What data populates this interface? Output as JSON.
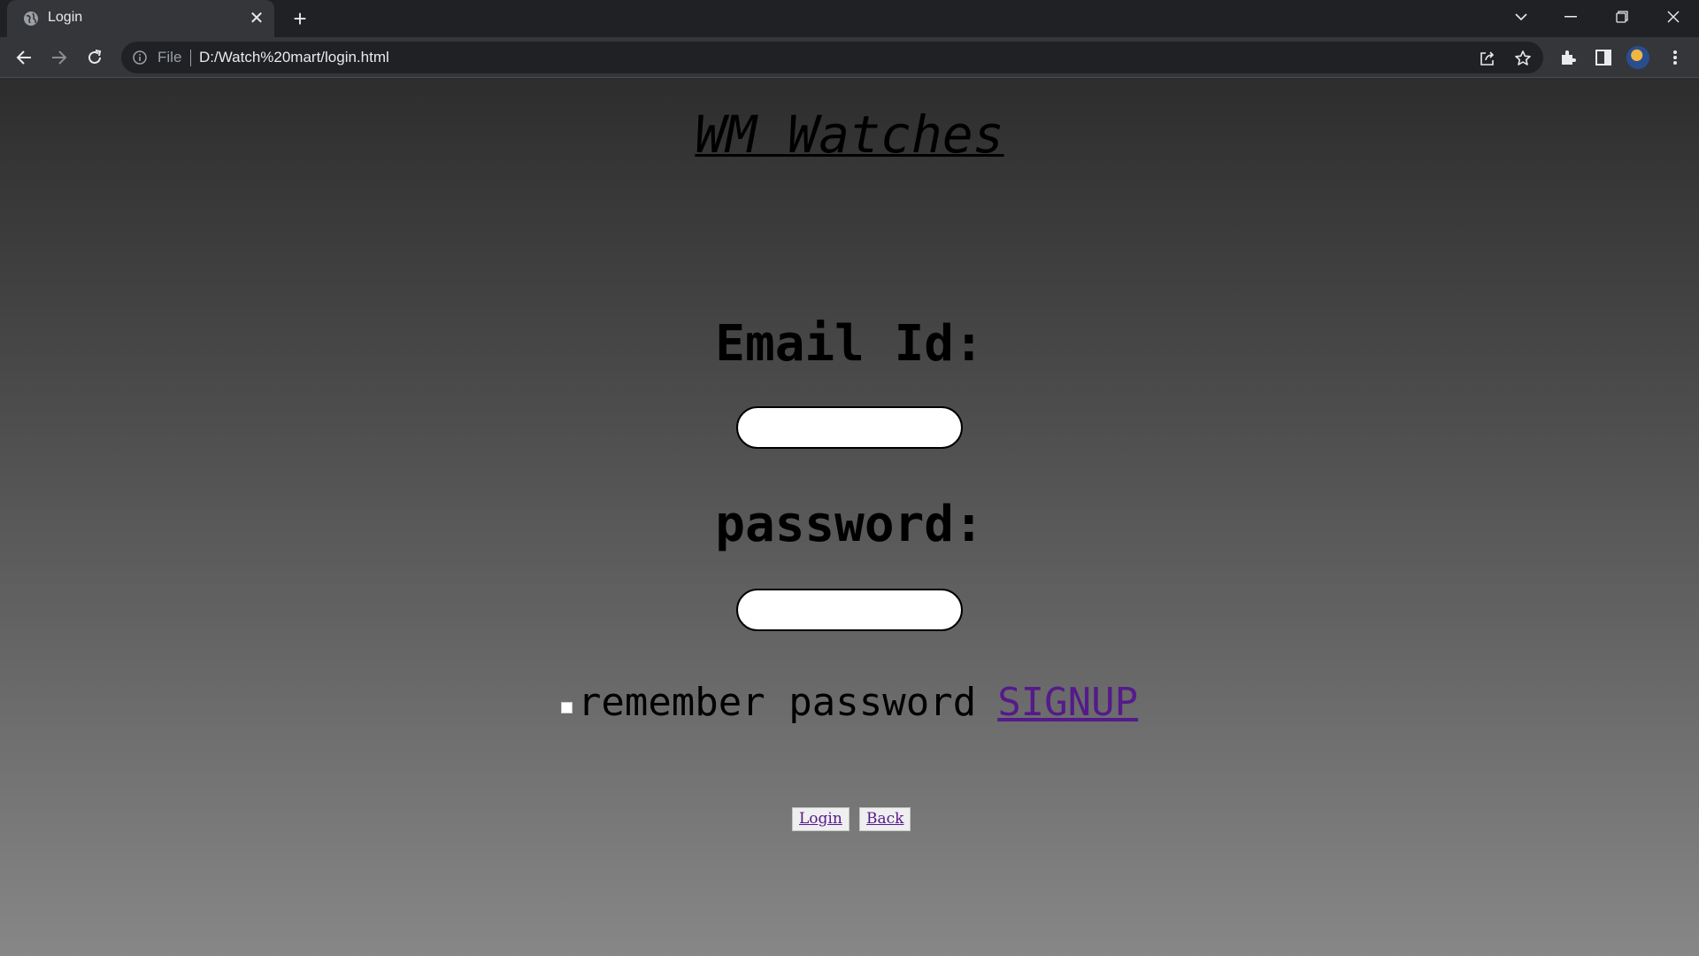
{
  "browser": {
    "tab_title": "Login",
    "url_scheme": "File",
    "url": "D:/Watch%20mart/login.html"
  },
  "page": {
    "site_title": "WM Watches",
    "email_label": "Email Id:",
    "email_value": "",
    "password_label": "password:",
    "password_value": "",
    "remember_label": "remember password",
    "remember_checked": false,
    "signup_link": "SIGNUP",
    "login_button": "Login",
    "back_button": "Back"
  }
}
